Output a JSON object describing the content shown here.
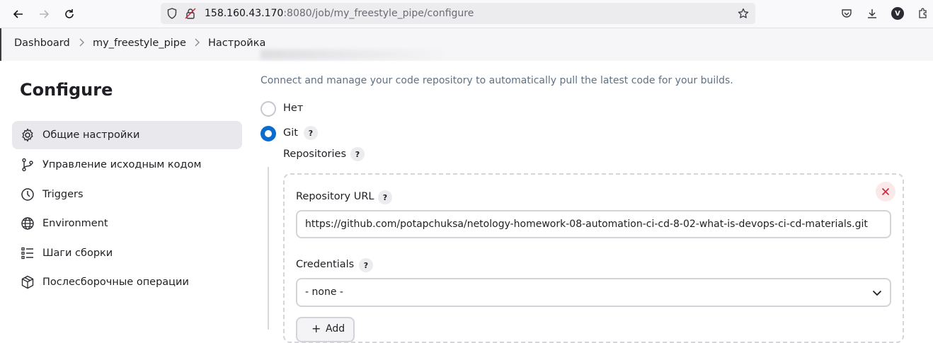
{
  "browser": {
    "url_host": "158.160.43.170",
    "url_rest": ":8080/job/my_freestyle_pipe/configure",
    "avatar_letter": "V"
  },
  "breadcrumb": {
    "items": [
      "Dashboard",
      "my_freestyle_pipe",
      "Настройка"
    ]
  },
  "sidebar": {
    "title": "Configure",
    "items": [
      {
        "label": "Общие настройки",
        "icon": "gear-icon"
      },
      {
        "label": "Управление исходным кодом",
        "icon": "branch-icon"
      },
      {
        "label": "Triggers",
        "icon": "clock-icon"
      },
      {
        "label": "Environment",
        "icon": "globe-icon"
      },
      {
        "label": "Шаги сборки",
        "icon": "list-icon"
      },
      {
        "label": "Послесборочные операции",
        "icon": "package-icon"
      }
    ]
  },
  "scm": {
    "description": "Connect and manage your code repository to automatically pull the latest code for your builds.",
    "option_none": "Нет",
    "option_git": "Git",
    "repositories_label": "Repositories",
    "repo_url_label": "Repository URL",
    "repo_url_value": "https://github.com/potapchuksa/netology-homework-08-automation-ci-cd-8-02-what-is-devops-ci-cd-materials.git",
    "credentials_label": "Credentials",
    "credentials_value": "- none -",
    "add_label": "Add",
    "help_symbol": "?"
  },
  "colors": {
    "accent": "#0a6ccf",
    "danger": "#d1243b"
  }
}
